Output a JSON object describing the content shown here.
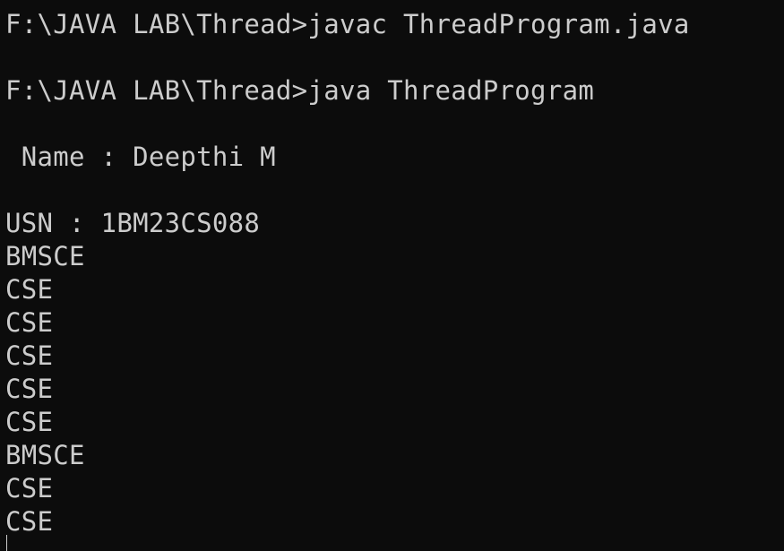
{
  "terminal": {
    "lines": [
      "F:\\JAVA LAB\\Thread>javac ThreadProgram.java",
      "F:\\JAVA LAB\\Thread>java ThreadProgram",
      " Name : Deepthi M",
      "USN : 1BM23CS088",
      "BMSCE",
      "CSE",
      "CSE",
      "CSE",
      "CSE",
      "CSE",
      "BMSCE",
      "CSE",
      "CSE"
    ]
  },
  "colors": {
    "background": "#0c0c0c",
    "text": "#cccccc"
  }
}
